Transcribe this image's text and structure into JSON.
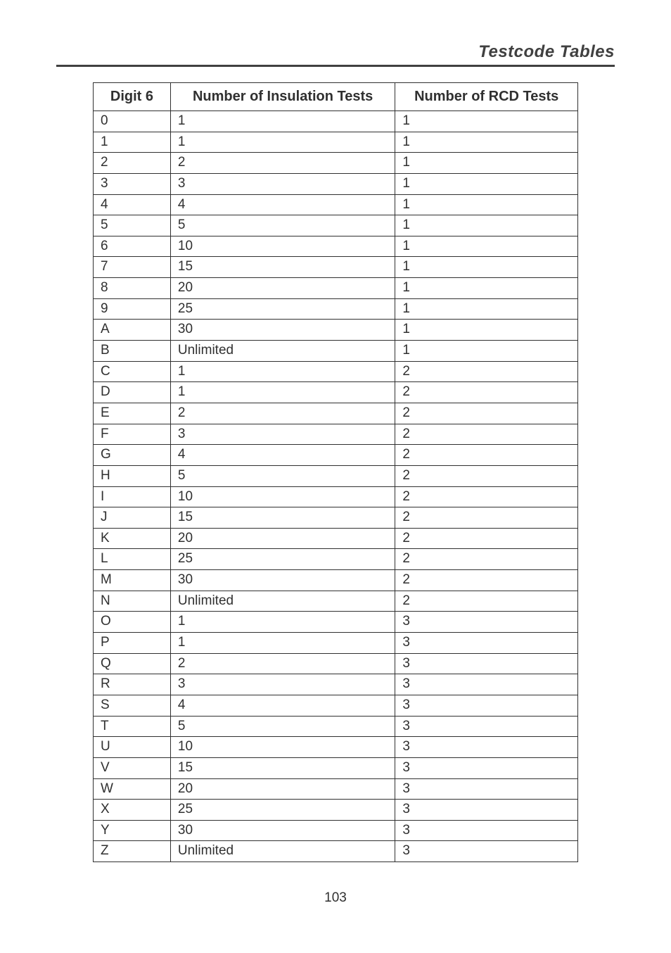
{
  "header": {
    "title": "Testcode Tables"
  },
  "table": {
    "headers": {
      "digit": "Digit 6",
      "insulation": "Number of Insulation Tests",
      "rcd": "Number of RCD Tests"
    },
    "rows": [
      {
        "digit": "0",
        "insulation": "1",
        "rcd": "1"
      },
      {
        "digit": "1",
        "insulation": "1",
        "rcd": "1"
      },
      {
        "digit": "2",
        "insulation": "2",
        "rcd": "1"
      },
      {
        "digit": "3",
        "insulation": "3",
        "rcd": "1"
      },
      {
        "digit": "4",
        "insulation": "4",
        "rcd": "1"
      },
      {
        "digit": "5",
        "insulation": "5",
        "rcd": "1"
      },
      {
        "digit": "6",
        "insulation": "10",
        "rcd": "1"
      },
      {
        "digit": "7",
        "insulation": "15",
        "rcd": "1"
      },
      {
        "digit": "8",
        "insulation": "20",
        "rcd": "1"
      },
      {
        "digit": "9",
        "insulation": "25",
        "rcd": "1"
      },
      {
        "digit": "A",
        "insulation": "30",
        "rcd": "1"
      },
      {
        "digit": "B",
        "insulation": "Unlimited",
        "rcd": "1"
      },
      {
        "digit": "C",
        "insulation": "1",
        "rcd": "2"
      },
      {
        "digit": "D",
        "insulation": "1",
        "rcd": "2"
      },
      {
        "digit": "E",
        "insulation": "2",
        "rcd": "2"
      },
      {
        "digit": "F",
        "insulation": "3",
        "rcd": "2"
      },
      {
        "digit": "G",
        "insulation": "4",
        "rcd": "2"
      },
      {
        "digit": "H",
        "insulation": "5",
        "rcd": "2"
      },
      {
        "digit": "I",
        "insulation": "10",
        "rcd": "2"
      },
      {
        "digit": "J",
        "insulation": "15",
        "rcd": "2"
      },
      {
        "digit": "K",
        "insulation": "20",
        "rcd": "2"
      },
      {
        "digit": "L",
        "insulation": "25",
        "rcd": "2"
      },
      {
        "digit": "M",
        "insulation": "30",
        "rcd": "2"
      },
      {
        "digit": "N",
        "insulation": "Unlimited",
        "rcd": "2"
      },
      {
        "digit": "O",
        "insulation": "1",
        "rcd": "3"
      },
      {
        "digit": "P",
        "insulation": "1",
        "rcd": "3"
      },
      {
        "digit": "Q",
        "insulation": "2",
        "rcd": "3"
      },
      {
        "digit": "R",
        "insulation": "3",
        "rcd": "3"
      },
      {
        "digit": "S",
        "insulation": "4",
        "rcd": "3"
      },
      {
        "digit": "T",
        "insulation": "5",
        "rcd": "3"
      },
      {
        "digit": "U",
        "insulation": "10",
        "rcd": "3"
      },
      {
        "digit": "V",
        "insulation": "15",
        "rcd": "3"
      },
      {
        "digit": "W",
        "insulation": "20",
        "rcd": "3"
      },
      {
        "digit": "X",
        "insulation": "25",
        "rcd": "3"
      },
      {
        "digit": "Y",
        "insulation": "30",
        "rcd": "3"
      },
      {
        "digit": "Z",
        "insulation": "Unlimited",
        "rcd": "3"
      }
    ]
  },
  "page_number": "103",
  "chart_data": {
    "type": "table",
    "title": "Testcode Tables — Digit 6",
    "columns": [
      "Digit 6",
      "Number of Insulation Tests",
      "Number of RCD Tests"
    ],
    "rows": [
      [
        "0",
        "1",
        "1"
      ],
      [
        "1",
        "1",
        "1"
      ],
      [
        "2",
        "2",
        "1"
      ],
      [
        "3",
        "3",
        "1"
      ],
      [
        "4",
        "4",
        "1"
      ],
      [
        "5",
        "5",
        "1"
      ],
      [
        "6",
        "10",
        "1"
      ],
      [
        "7",
        "15",
        "1"
      ],
      [
        "8",
        "20",
        "1"
      ],
      [
        "9",
        "25",
        "1"
      ],
      [
        "A",
        "30",
        "1"
      ],
      [
        "B",
        "Unlimited",
        "1"
      ],
      [
        "C",
        "1",
        "2"
      ],
      [
        "D",
        "1",
        "2"
      ],
      [
        "E",
        "2",
        "2"
      ],
      [
        "F",
        "3",
        "2"
      ],
      [
        "G",
        "4",
        "2"
      ],
      [
        "H",
        "5",
        "2"
      ],
      [
        "I",
        "10",
        "2"
      ],
      [
        "J",
        "15",
        "2"
      ],
      [
        "K",
        "20",
        "2"
      ],
      [
        "L",
        "25",
        "2"
      ],
      [
        "M",
        "30",
        "2"
      ],
      [
        "N",
        "Unlimited",
        "2"
      ],
      [
        "O",
        "1",
        "3"
      ],
      [
        "P",
        "1",
        "3"
      ],
      [
        "Q",
        "2",
        "3"
      ],
      [
        "R",
        "3",
        "3"
      ],
      [
        "S",
        "4",
        "3"
      ],
      [
        "T",
        "5",
        "3"
      ],
      [
        "U",
        "10",
        "3"
      ],
      [
        "V",
        "15",
        "3"
      ],
      [
        "W",
        "20",
        "3"
      ],
      [
        "X",
        "25",
        "3"
      ],
      [
        "Y",
        "30",
        "3"
      ],
      [
        "Z",
        "Unlimited",
        "3"
      ]
    ]
  }
}
